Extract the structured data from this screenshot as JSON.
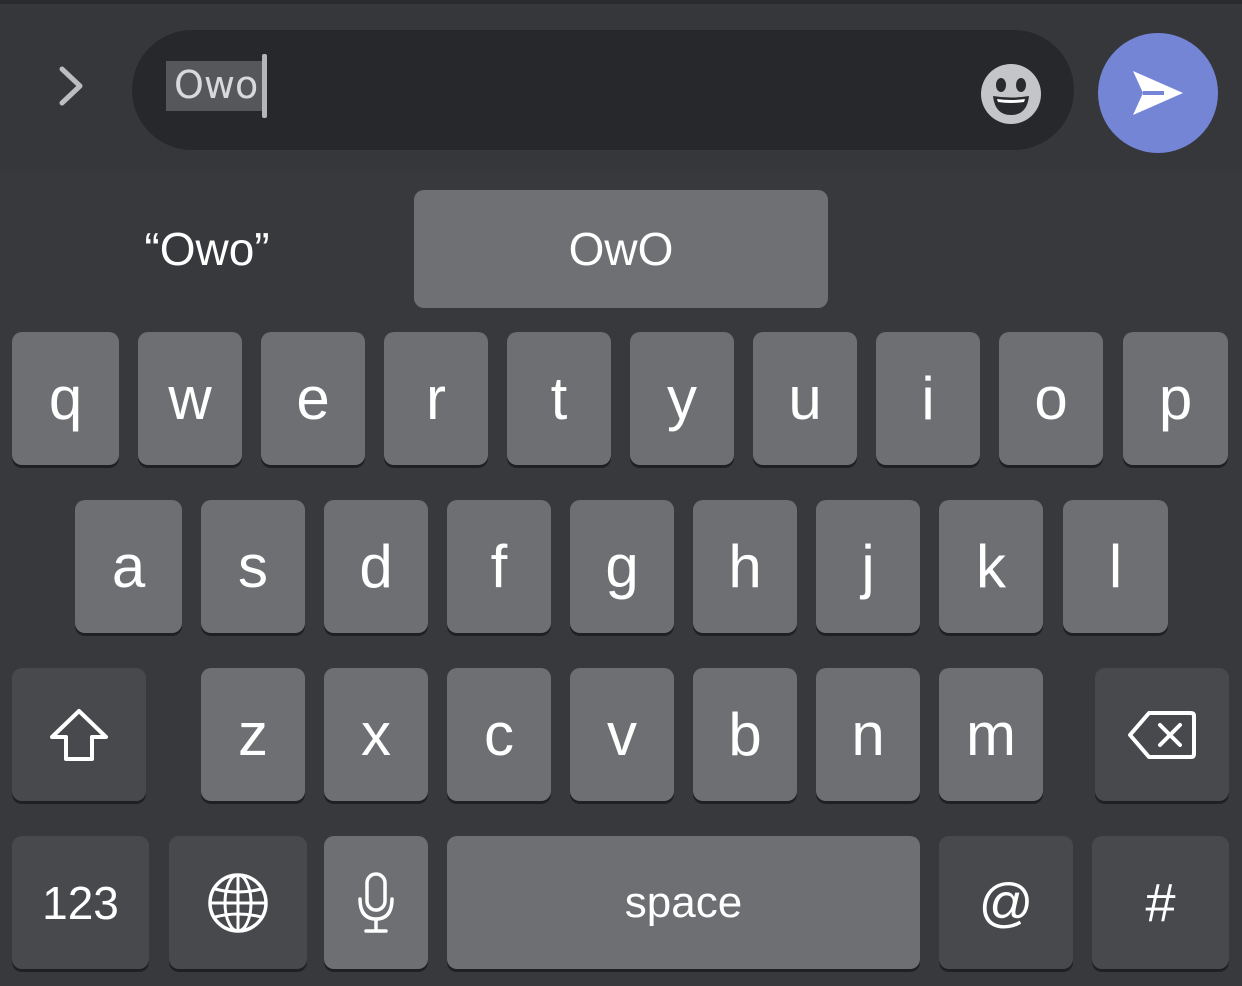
{
  "composer": {
    "input_value": "Owo",
    "expand_icon": "chevron-right-icon",
    "emoji_icon": "smiley-icon",
    "send_icon": "send-arrow-icon",
    "send_color": "#7485d6"
  },
  "suggestions": {
    "literal": "“Owo”",
    "primary": "OwO",
    "third": ""
  },
  "keyboard": {
    "row1": [
      "q",
      "w",
      "e",
      "r",
      "t",
      "y",
      "u",
      "i",
      "o",
      "p"
    ],
    "row2": [
      "a",
      "s",
      "d",
      "f",
      "g",
      "h",
      "j",
      "k",
      "l"
    ],
    "row3": [
      "z",
      "x",
      "c",
      "v",
      "b",
      "n",
      "m"
    ],
    "shift_icon": "shift-arrow-icon",
    "delete_icon": "backspace-icon",
    "numbers_label": "123",
    "globe_icon": "globe-icon",
    "mic_icon": "microphone-icon",
    "space_label": "space",
    "at_label": "@",
    "hash_label": "#"
  }
}
